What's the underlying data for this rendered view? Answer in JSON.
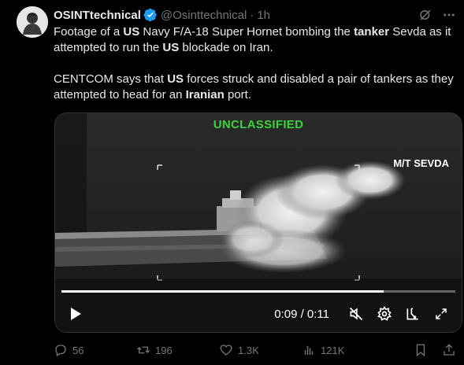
{
  "account": {
    "display_name": "OSINTtechnical",
    "handle": "@Osinttechnical",
    "separator": "·",
    "time": "1h"
  },
  "tweet": {
    "paragraph1": [
      {
        "text": "Footage of a ",
        "bold": false
      },
      {
        "text": "US",
        "bold": true
      },
      {
        "text": " Navy F/A-18 Super Hornet bombing the ",
        "bold": false
      },
      {
        "text": "tanker",
        "bold": true
      },
      {
        "text": " Sevda as it attempted to run the ",
        "bold": false
      },
      {
        "text": "US",
        "bold": true
      },
      {
        "text": " blockade on Iran.",
        "bold": false
      }
    ],
    "paragraph2": [
      {
        "text": "CENTCOM says that ",
        "bold": false
      },
      {
        "text": "US",
        "bold": true
      },
      {
        "text": " forces struck and disabled a pair of tankers as they attempted to head for an ",
        "bold": false
      },
      {
        "text": "Iranian",
        "bold": true
      },
      {
        "text": " port.",
        "bold": false
      }
    ]
  },
  "video": {
    "overlay_top": "UNCLASSIFIED",
    "vessel_label": "M/T SEVDA",
    "time_readout": "0:09 / 0:11",
    "progress": 0.818
  },
  "actions": {
    "replies": "56",
    "reposts": "196",
    "likes": "1.3K",
    "views": "121K"
  },
  "icons": {
    "verified": "verified-badge-icon",
    "grok": "grok-icon",
    "more": "more-icon",
    "play": "play-icon",
    "mute": "mute-icon",
    "settings": "settings-icon",
    "popout": "popout-icon",
    "fullscreen": "fullscreen-icon",
    "reply": "reply-icon",
    "repost": "repost-icon",
    "like": "like-icon",
    "views": "views-icon",
    "bookmark": "bookmark-icon",
    "share": "share-icon"
  },
  "colors": {
    "background": "#000000",
    "text": "#e7e9ea",
    "muted": "#71767b",
    "verified_blue": "#1d9bf0",
    "unclassified_green": "#38d438"
  }
}
